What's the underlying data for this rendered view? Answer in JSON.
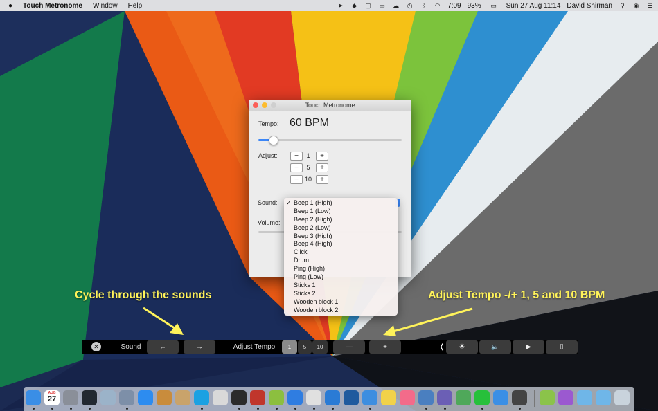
{
  "menubar": {
    "apple": "",
    "app_name": "Touch Metronome",
    "menus": [
      "Window",
      "Help"
    ],
    "time_badge": "7:09",
    "battery": "93%",
    "datetime": "Sun 27 Aug  11:14",
    "user": "David Shirman",
    "status_icons": [
      "location-icon",
      "dropbox-icon",
      "screen-icon",
      "airplay-icon",
      "cloud-icon",
      "time-machine-icon",
      "bluetooth-icon",
      "wifi-icon"
    ]
  },
  "window": {
    "title": "Touch Metronome",
    "tempo_label": "Tempo:",
    "tempo_value": "60 BPM",
    "tempo_level": 0.1,
    "adjust_label": "Adjust:",
    "adjust_steps": [
      "1",
      "5",
      "10"
    ],
    "minus": "−",
    "plus": "+",
    "sound_label": "Sound:",
    "volume_label": "Volume:"
  },
  "sound_menu": {
    "selected": "Beep 1 (High)",
    "check": "✓",
    "options": [
      "Beep 1 (High)",
      "Beep 1 (Low)",
      "Beep 2 (High)",
      "Beep 2 (Low)",
      "Beep 3 (High)",
      "Beep 4 (High)",
      "Click",
      "Drum",
      "Ping (High)",
      "Ping (Low)",
      "Sticks 1",
      "Sticks 2",
      "Wooden block 1",
      "Wooden block 2"
    ]
  },
  "annotations": {
    "left": "Cycle through the sounds",
    "right": "Adjust Tempo -/+ 1, 5 and 10 BPM"
  },
  "touchbar": {
    "close": "✕",
    "sound_label": "Sound",
    "prev": "←",
    "next": "→",
    "adjust_label": "Adjust Tempo",
    "segments": [
      "1",
      "5",
      "10"
    ],
    "minus": "—",
    "plus": "+",
    "collapse": "❬",
    "brightness": "☀",
    "volume": "🔈",
    "play": "▶",
    "screenshot": "⌷"
  },
  "dock": {
    "calendar_month": "AUG",
    "calendar_day": "27",
    "apps": [
      "finder",
      "calendar",
      "system-preferences",
      "activity-monitor",
      "preview",
      "launchpad",
      "app-store",
      "books",
      "archive",
      "skype",
      "script-editor",
      "terminal",
      "filezilla",
      "android-file",
      "safari",
      "chrome",
      "visual-studio-code",
      "sourcetree",
      "xcode",
      "notes",
      "itunes",
      "preview-photo",
      "bbedit",
      "numbers",
      "whatsapp",
      "xcode-tools",
      "console",
      "android-studio",
      "android-emulator",
      "folder-downloads",
      "folder-documents",
      "trash"
    ]
  },
  "colors": {
    "accent": "#3b86f7",
    "annotation": "#fff35a"
  }
}
